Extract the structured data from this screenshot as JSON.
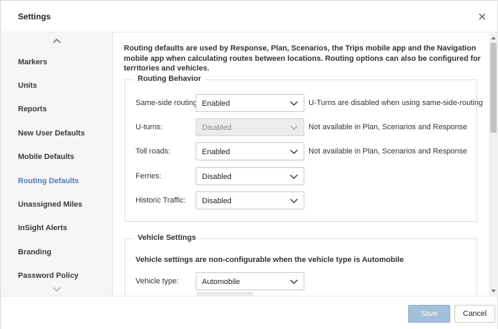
{
  "dialog": {
    "title": "Settings"
  },
  "sidebar": {
    "items": [
      {
        "label": "Markers"
      },
      {
        "label": "Units"
      },
      {
        "label": "Reports"
      },
      {
        "label": "New User Defaults"
      },
      {
        "label": "Mobile Defaults"
      },
      {
        "label": "Routing Defaults",
        "active": true
      },
      {
        "label": "Unassigned Miles"
      },
      {
        "label": "InSight Alerts"
      },
      {
        "label": "Branding"
      },
      {
        "label": "Password Policy"
      }
    ]
  },
  "content": {
    "intro": "Routing defaults are used by Response, Plan, Scenarios, the Trips mobile app and the Navigation mobile app when calculating routes between locations. Routing options can also be configured for territories and vehicles.",
    "routing": {
      "legend": "Routing Behavior",
      "rows": [
        {
          "label": "Same-side routing:",
          "value": "Enabled",
          "note": "U-Turns are disabled when using same-side-routing"
        },
        {
          "label": "U-turns:",
          "value": "Disabled",
          "note": "Not available in Plan, Scenarios and Response",
          "disabled": true
        },
        {
          "label": "Toll roads:",
          "value": "Enabled",
          "note": "Not available in Plan, Scenarios and Response"
        },
        {
          "label": "Ferries:",
          "value": "Disabled",
          "note": ""
        },
        {
          "label": "Historic Traffic:",
          "value": "Disabled",
          "note": ""
        }
      ]
    },
    "vehicle": {
      "legend": "Vehicle Settings",
      "note": "Vehicle settings are non-configurable when the vehicle type is Automobile",
      "type_label": "Vehicle type:",
      "type_value": "Automobile"
    }
  },
  "footer": {
    "save_label": "Save",
    "cancel_label": "Cancel"
  },
  "colors": {
    "accent": "#4a7db5",
    "save_bg": "#a3bfd9",
    "sidebar_bg": "#f6f6f7"
  }
}
